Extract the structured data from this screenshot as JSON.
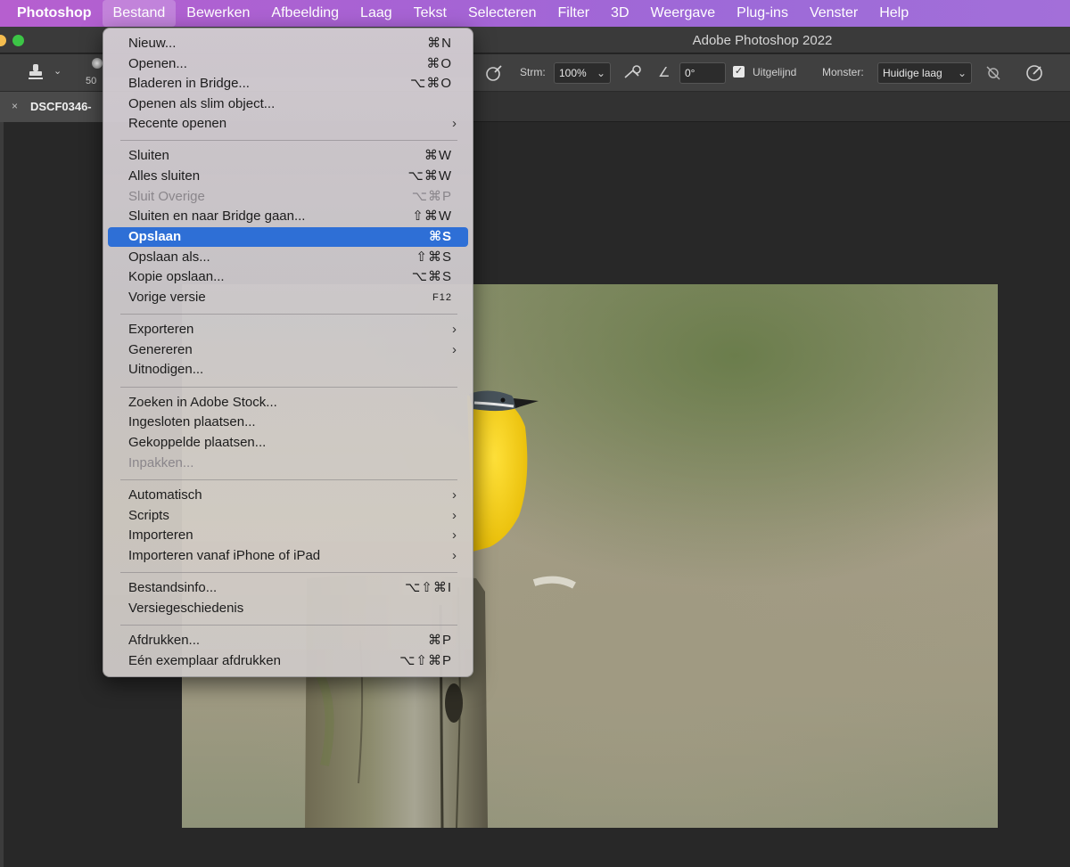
{
  "menubar": {
    "app": "Photoshop",
    "items": [
      "Bestand",
      "Bewerken",
      "Afbeelding",
      "Laag",
      "Tekst",
      "Selecteren",
      "Filter",
      "3D",
      "Weergave",
      "Plug-ins",
      "Venster",
      "Help"
    ],
    "active": "Bestand"
  },
  "window": {
    "title": "Adobe Photoshop 2022"
  },
  "options": {
    "brush_size": "50",
    "flow_label": "Strm:",
    "flow_value": "100%",
    "angle_value": "0°",
    "aligned_label": "Uitgelijnd",
    "aligned_checked": true,
    "sample_label": "Monster:",
    "sample_value": "Huidige laag"
  },
  "document_tab": {
    "name": "DSCF0346-",
    "close": "×"
  },
  "file_menu": {
    "items": [
      {
        "label": "Nieuw...",
        "shortcut": "⌘N"
      },
      {
        "label": "Openen...",
        "shortcut": "⌘O"
      },
      {
        "label": "Bladeren in Bridge...",
        "shortcut": "⌥⌘O"
      },
      {
        "label": "Openen als slim object..."
      },
      {
        "label": "Recente openen",
        "submenu": "›"
      },
      {
        "label": "Sluiten",
        "shortcut": "⌘W"
      },
      {
        "label": "Alles sluiten",
        "shortcut": "⌥⌘W"
      },
      {
        "label": "Sluit Overige",
        "shortcut": "⌥⌘P",
        "disabled": true
      },
      {
        "label": "Sluiten en naar Bridge gaan...",
        "shortcut": "⇧⌘W"
      },
      {
        "label": "Opslaan",
        "shortcut": "⌘S",
        "highlighted": true
      },
      {
        "label": "Opslaan als...",
        "shortcut": "⇧⌘S"
      },
      {
        "label": "Kopie opslaan...",
        "shortcut": "⌥⌘S"
      },
      {
        "label": "Vorige versie",
        "shortcut": "F12"
      },
      {
        "label": "Exporteren",
        "submenu": "›"
      },
      {
        "label": "Genereren",
        "submenu": "›"
      },
      {
        "label": "Uitnodigen..."
      },
      {
        "label": "Zoeken in Adobe Stock..."
      },
      {
        "label": "Ingesloten plaatsen..."
      },
      {
        "label": "Gekoppelde plaatsen..."
      },
      {
        "label": "Inpakken...",
        "disabled": true
      },
      {
        "label": "Automatisch",
        "submenu": "›"
      },
      {
        "label": "Scripts",
        "submenu": "›"
      },
      {
        "label": "Importeren",
        "submenu": "›"
      },
      {
        "label": "Importeren vanaf iPhone of iPad",
        "submenu": "›"
      },
      {
        "label": "Bestandsinfo...",
        "shortcut": "⌥⇧⌘I"
      },
      {
        "label": "Versiegeschiedenis"
      },
      {
        "label": "Afdrukken...",
        "shortcut": "⌘P"
      },
      {
        "label": "Eén exemplaar afdrukken",
        "shortcut": "⌥⇧⌘P"
      }
    ]
  },
  "colors": {
    "menubar": "#a663d4",
    "highlight": "#2e6fd6",
    "bird_yellow": "#f2cc10"
  },
  "icons": [
    "stamp-icon",
    "chevron-down-icon",
    "airbrush-icon",
    "angle-icon",
    "ignore-adjustment-icon",
    "pressure-icon"
  ]
}
